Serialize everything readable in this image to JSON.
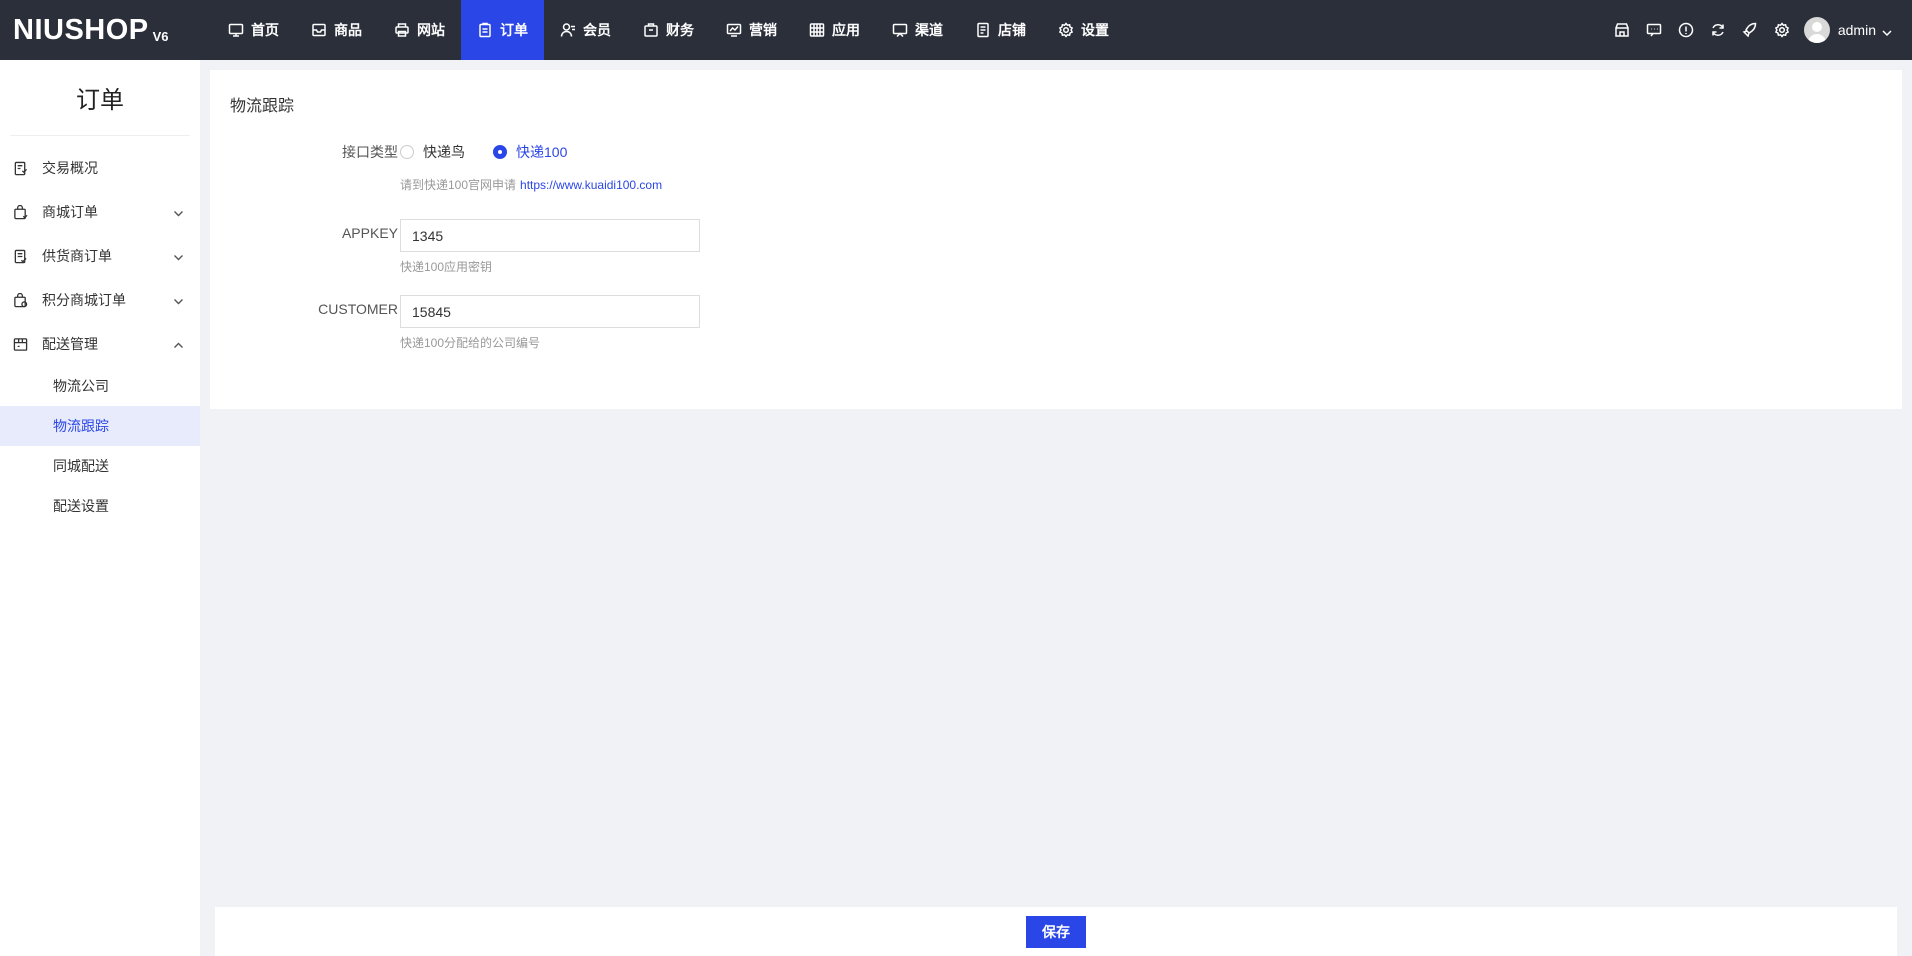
{
  "logo": {
    "main": "NIUSHOP",
    "version": "V6"
  },
  "nav": [
    {
      "label": "首页",
      "icon": "monitor-icon",
      "active": false
    },
    {
      "label": "商品",
      "icon": "inbox-icon",
      "active": false
    },
    {
      "label": "网站",
      "icon": "printer-icon",
      "active": false
    },
    {
      "label": "订单",
      "icon": "clipboard-icon",
      "active": true
    },
    {
      "label": "会员",
      "icon": "user-icon",
      "active": false
    },
    {
      "label": "财务",
      "icon": "box-icon",
      "active": false
    },
    {
      "label": "营销",
      "icon": "chart-icon",
      "active": false
    },
    {
      "label": "应用",
      "icon": "grid-icon",
      "active": false
    },
    {
      "label": "渠道",
      "icon": "display-icon",
      "active": false
    },
    {
      "label": "店铺",
      "icon": "document-icon",
      "active": false
    },
    {
      "label": "设置",
      "icon": "gear-icon",
      "active": false
    }
  ],
  "top_right": {
    "icons": [
      "store-icon",
      "message-icon",
      "info-icon",
      "refresh-icon",
      "rocket-icon",
      "gear-icon"
    ],
    "username": "admin"
  },
  "sidebar": {
    "title": "订单",
    "items": [
      {
        "label": "交易概况",
        "icon": "report-icon"
      },
      {
        "label": "商城订单",
        "icon": "bag-icon"
      },
      {
        "label": "供货商订单",
        "icon": "supplier-icon"
      },
      {
        "label": "积分商城订单",
        "icon": "points-icon"
      },
      {
        "label": "配送管理",
        "icon": "delivery-icon"
      }
    ],
    "sub_items": [
      "物流公司",
      "物流跟踪",
      "同城配送",
      "配送设置"
    ],
    "active_sub": "物流跟踪"
  },
  "form": {
    "title": "物流跟踪",
    "interface_label": "接口类型",
    "radio_options": [
      "快递鸟",
      "快递100"
    ],
    "selected": "快递100",
    "interface_hint": "请到快递100官网申请",
    "interface_link": "https://www.kuaidi100.com",
    "appkey_label": "APPKEY",
    "appkey_value": "1345",
    "appkey_hint": "快递100应用密钥",
    "customer_label": "CUSTOMER",
    "customer_value": "15845",
    "customer_hint": "快递100分配给的公司编号"
  },
  "footer": {
    "save_label": "保存"
  },
  "colors": {
    "primary": "#2b46e6",
    "topbar": "#2b2f3a",
    "background": "#f0f2f5"
  }
}
